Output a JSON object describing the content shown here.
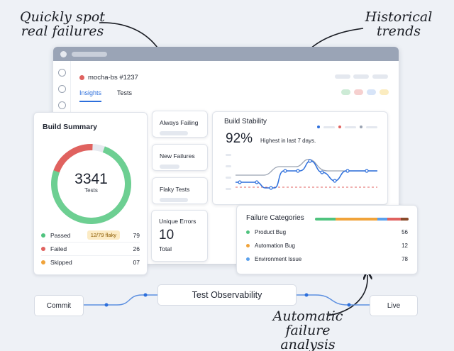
{
  "annotations": {
    "spot_failures": "Quickly spot\nreal failures",
    "historical": "Historical\ntrends",
    "automatic": "Automatic\nfailure analysis"
  },
  "window": {
    "build_name": "mocha-bs #1237",
    "tabs": [
      {
        "label": "Insights",
        "active": true
      },
      {
        "label": "Tests",
        "active": false
      }
    ]
  },
  "filters": {
    "always_failing": "Always Failing",
    "new_failures": "New Failures",
    "flaky_tests": "Flaky Tests"
  },
  "build_summary": {
    "title": "Build Summary",
    "total": "3341",
    "total_label": "Tests",
    "donut": {
      "passed_fraction": 0.75,
      "failed_fraction": 0.2,
      "skipped_fraction": 0.05
    },
    "rows": [
      {
        "label": "Passed",
        "badge": "12/79 flaky",
        "value": "79",
        "color": "#4fc37e"
      },
      {
        "label": "Failed",
        "badge": "",
        "value": "26",
        "color": "#e0625f"
      },
      {
        "label": "Skipped",
        "badge": "",
        "value": "07",
        "color": "#f0a33a"
      }
    ]
  },
  "build_stability": {
    "title": "Build Stability",
    "percent": "92%",
    "note": "Highest in last 7 days.",
    "colors": {
      "series_a": "#2d6fdc",
      "series_b": "#9aa3b2",
      "threshold": "#e0625f"
    }
  },
  "unique_errors": {
    "title": "Unique Errors",
    "value": "10",
    "label": "Total"
  },
  "failure_categories": {
    "title": "Failure Categories",
    "bar": [
      {
        "color": "#4fc37e",
        "fraction": 0.22
      },
      {
        "color": "#f0a33a",
        "fraction": 0.45
      },
      {
        "color": "#5aa0ec",
        "fraction": 0.1
      },
      {
        "color": "#e0625f",
        "fraction": 0.15
      },
      {
        "color": "#8a4a2a",
        "fraction": 0.08
      }
    ],
    "rows": [
      {
        "label": "Product Bug",
        "value": "56",
        "color": "#4fc37e"
      },
      {
        "label": "Automation Bug",
        "value": "12",
        "color": "#f0a33a"
      },
      {
        "label": "Environment Issue",
        "value": "78",
        "color": "#5aa0ec"
      }
    ]
  },
  "flow": {
    "commit": "Commit",
    "observability": "Test Observability",
    "live": "Live"
  }
}
